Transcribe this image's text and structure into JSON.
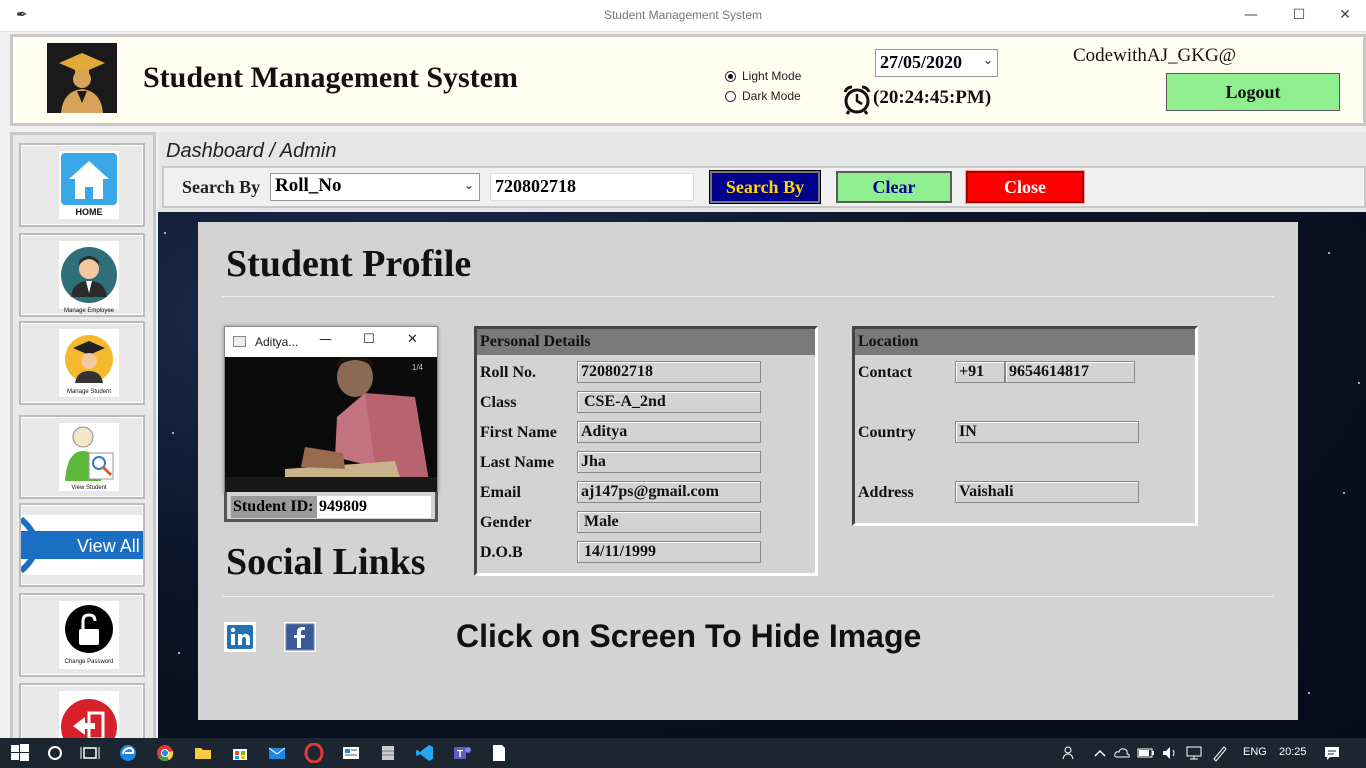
{
  "window": {
    "title": "Student Management System",
    "minimize_label": "—",
    "maximize_label": "☐",
    "close_label": "✕"
  },
  "header": {
    "app_title": "Student Management System",
    "theme_options": [
      {
        "label": "Light Mode",
        "selected": true
      },
      {
        "label": "Dark Mode",
        "selected": false
      }
    ],
    "date": "27/05/2020",
    "time": "(20:24:45:PM)",
    "user": "CodewithAJ_GKG@",
    "logout_label": "Logout"
  },
  "sidebar": {
    "items": [
      {
        "label": "HOME",
        "icon": "home-icon"
      },
      {
        "label": "Manage Employee",
        "icon": "employee-icon"
      },
      {
        "label": "Manage Student",
        "icon": "student-icon"
      },
      {
        "label": "View Student",
        "icon": "view-student-icon"
      },
      {
        "label": "View All",
        "icon": "view-all-icon"
      },
      {
        "label": "Change Password",
        "icon": "lock-icon"
      },
      {
        "label": "",
        "icon": "exit-icon"
      }
    ]
  },
  "breadcrumb": "Dashboard / Admin",
  "search": {
    "label": "Search By",
    "field": "Roll_No",
    "value": "720802718",
    "search_button": "Search By",
    "clear_button": "Clear",
    "close_button": "Close"
  },
  "profile": {
    "title": "Student Profile",
    "photo_window_title": "Aditya...",
    "photo_counter": "1/4",
    "student_id_label": "Student ID:",
    "student_id": "949809",
    "social_title": "Social Links",
    "hint": "Click on Screen To Hide Image",
    "personal": {
      "heading": "Personal Details",
      "rows": [
        {
          "label": "Roll No.",
          "value": "720802718"
        },
        {
          "label": "Class",
          "value": "CSE-A_2nd"
        },
        {
          "label": "First Name",
          "value": "Aditya"
        },
        {
          "label": "Last Name",
          "value": "Jha"
        },
        {
          "label": "Email",
          "value": "aj147ps@gmail.com"
        },
        {
          "label": "Gender",
          "value": "Male"
        },
        {
          "label": "D.O.B",
          "value": "14/11/1999"
        }
      ]
    },
    "location": {
      "heading": "Location",
      "contact_label": "Contact",
      "country_code": "+91",
      "phone": "9654614817",
      "country_label": "Country",
      "country": "IN",
      "address_label": "Address",
      "address": "Vaishali"
    },
    "social": [
      "linkedin-icon",
      "facebook-icon"
    ]
  },
  "taskbar": {
    "language": "ENG",
    "time": "20:25"
  },
  "colors": {
    "header_bg": "#fffef0",
    "panel_bg": "#d3d3d3",
    "green_button": "#8fef8f",
    "search_button_bg": "#00008b",
    "search_button_text": "#ffd700",
    "close_button": "#ff0000"
  }
}
